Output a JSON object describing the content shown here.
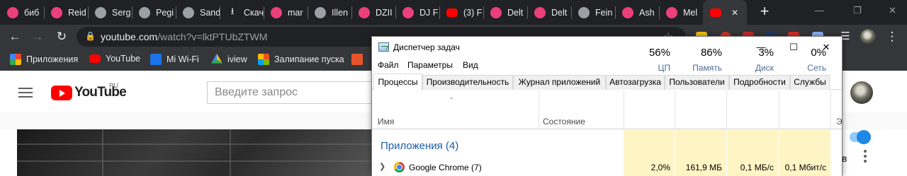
{
  "browser": {
    "tabs": [
      {
        "title": "биб",
        "icon": "pink-circle-icon"
      },
      {
        "title": "Reid",
        "icon": "pink-circle-icon"
      },
      {
        "title": "Serg",
        "icon": "globe-icon"
      },
      {
        "title": "Pegi",
        "icon": "globe-icon"
      },
      {
        "title": "Sand",
        "icon": "globe-icon"
      },
      {
        "title": "Скач",
        "icon": "download-icon"
      },
      {
        "title": "mar",
        "icon": "pink-circle-icon"
      },
      {
        "title": "Illen",
        "icon": "globe-icon"
      },
      {
        "title": "DZII",
        "icon": "pink-circle-icon"
      },
      {
        "title": "DJ F",
        "icon": "pink-circle-icon"
      },
      {
        "title": "(3) F",
        "icon": "youtube-icon"
      },
      {
        "title": "Delt",
        "icon": "pink-circle-icon"
      },
      {
        "title": "Delt",
        "icon": "pink-circle-icon"
      },
      {
        "title": "Fein",
        "icon": "globe-icon"
      },
      {
        "title": "Ash",
        "icon": "pink-circle-icon"
      },
      {
        "title": "Mel",
        "icon": "pink-circle-icon"
      },
      {
        "title": "",
        "icon": "youtube-icon",
        "active": true
      }
    ],
    "new_tab_label": "+",
    "url_host": "youtube.com",
    "url_path": "/watch?v=lktPTUbZTWM",
    "bookmarks": [
      {
        "label": "Приложения",
        "icon": "apps-grid-icon"
      },
      {
        "label": "YouTube",
        "icon": "youtube-icon"
      },
      {
        "label": "Mi Wi-Fi",
        "icon": "wifi-icon"
      },
      {
        "label": "iview",
        "icon": "drive-icon"
      },
      {
        "label": "Залипание пуска",
        "icon": "windows-icon"
      }
    ],
    "colors": {
      "tab_bg": "#202124",
      "toolbar_bg": "#35363a",
      "accent_pink": "#ec407a",
      "youtube_red": "#ff0000"
    }
  },
  "youtube": {
    "logo_text": "YouTube",
    "region": "RU",
    "search_placeholder": "Введите запрос",
    "sidebar_letter": "в"
  },
  "task_manager": {
    "title": "Диспетчер задач",
    "menu": [
      "Файл",
      "Параметры",
      "Вид"
    ],
    "tabs": [
      "Процессы",
      "Производительность",
      "Журнал приложений",
      "Автозагрузка",
      "Пользователи",
      "Подробности",
      "Службы"
    ],
    "active_tab": "Процессы",
    "columns": {
      "name": "Имя",
      "status": "Состояние",
      "cpu": {
        "pct": "56%",
        "label": "ЦП"
      },
      "memory": {
        "pct": "86%",
        "label": "Память"
      },
      "disk": {
        "pct": "3%",
        "label": "Диск"
      },
      "network": {
        "pct": "0%",
        "label": "Сеть"
      },
      "extra": "Э"
    },
    "group": "Приложения (4)",
    "rows": [
      {
        "name": "Google Chrome (7)",
        "cpu": "2,0%",
        "memory": "161,9 МБ",
        "disk": "0,1 МБ/с",
        "network": "0,1 Мбит/с"
      }
    ],
    "colors": {
      "highlight": "#fff4c4",
      "group_text": "#1c5da6"
    }
  }
}
